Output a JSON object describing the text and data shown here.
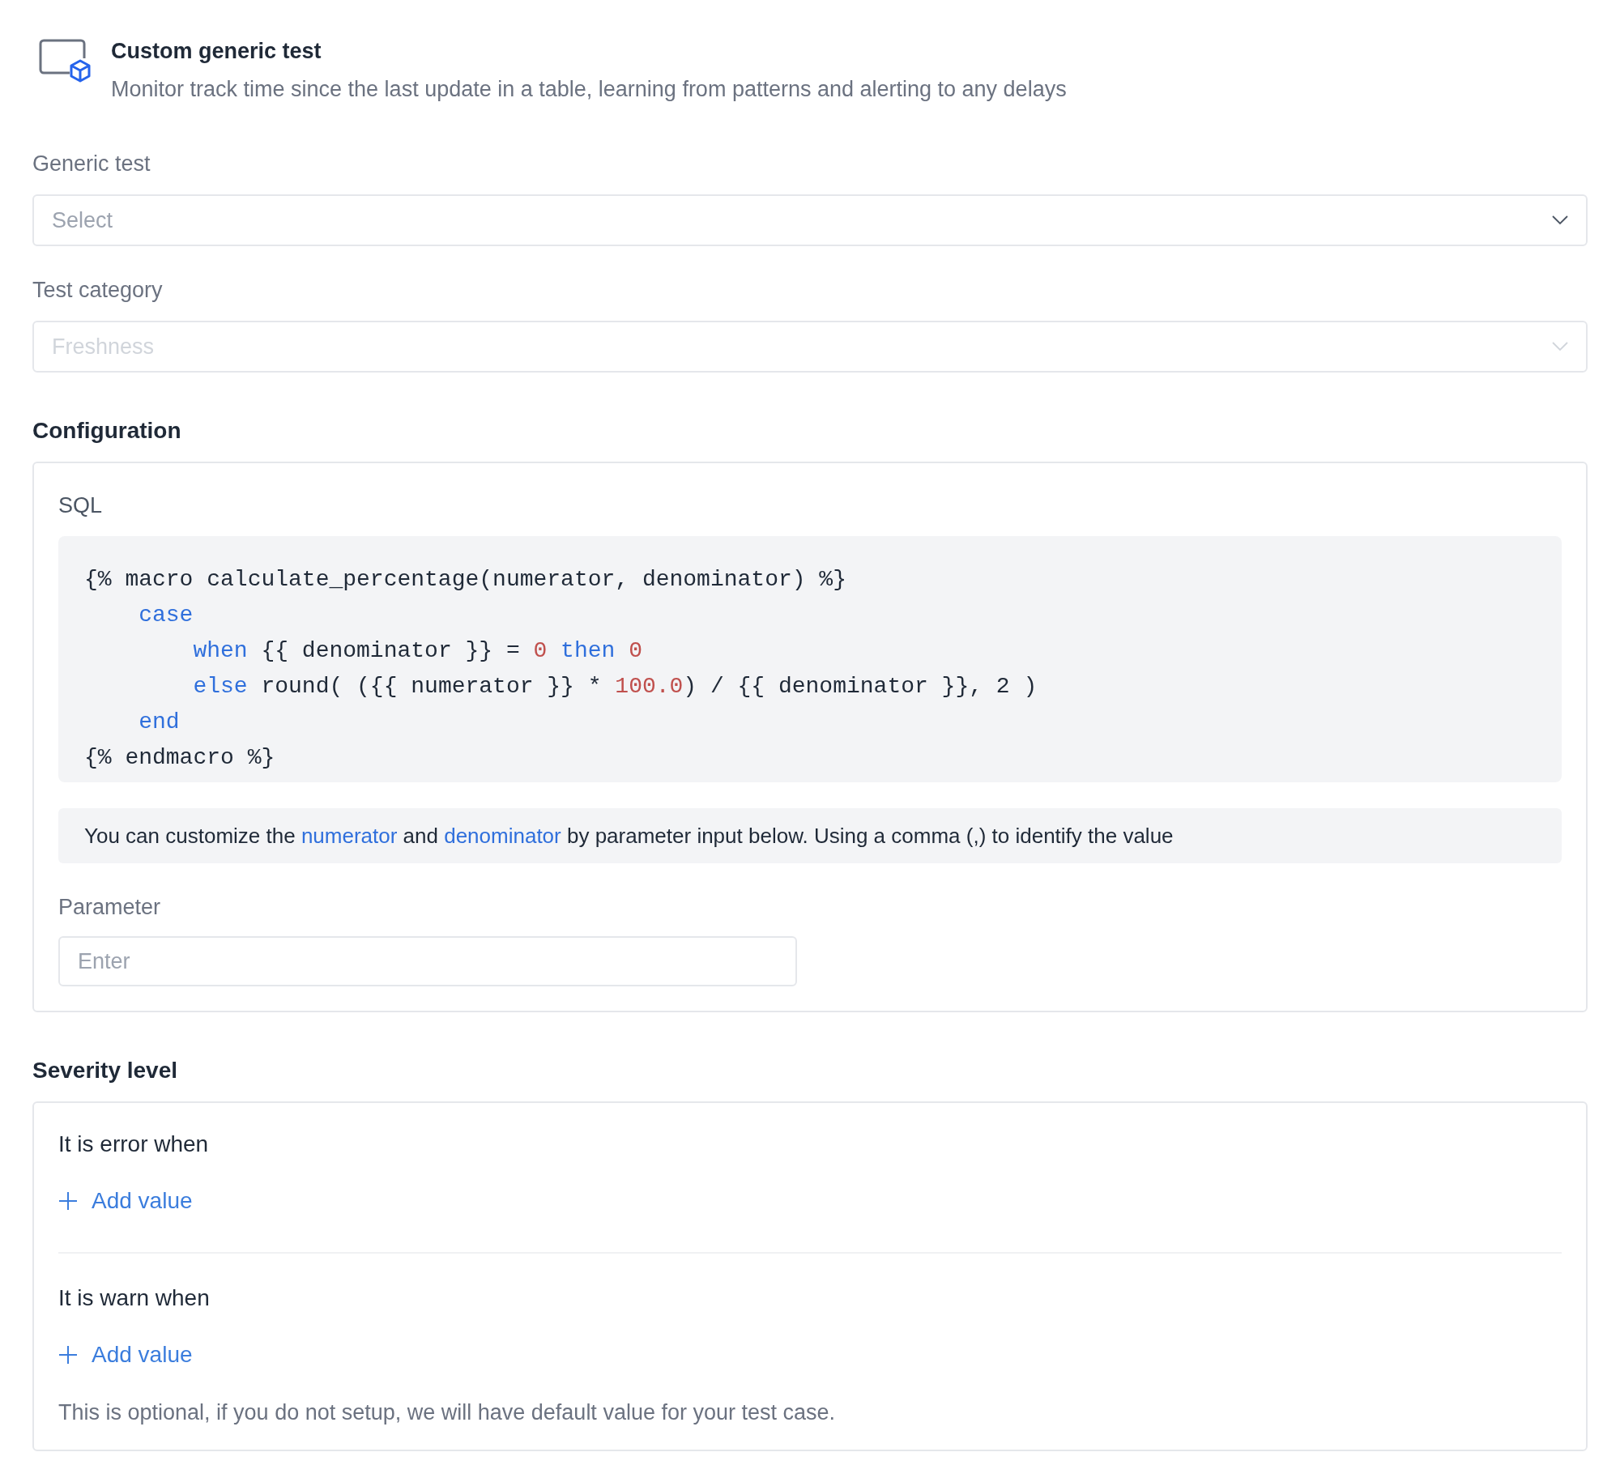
{
  "header": {
    "title": "Custom generic test",
    "description": "Monitor track time since the last update in a table, learning from patterns and alerting to any delays"
  },
  "fields": [
    {
      "label": "Generic test",
      "placeholder": "Select",
      "disabled": false
    },
    {
      "label": "Test category",
      "placeholder": "Freshness",
      "disabled": true
    }
  ],
  "configuration": {
    "heading": "Configuration",
    "sql_label": "SQL",
    "code_lines": [
      {
        "tokens": [
          {
            "kind": "plain",
            "text": "{% macro calculate_percentage(numerator, denominator) %}"
          }
        ],
        "children": [
          {
            "tokens": [
              {
                "kind": "keyword",
                "text": "case"
              }
            ],
            "children": [
              {
                "tokens": [
                  {
                    "kind": "keyword",
                    "text": "when"
                  },
                  {
                    "kind": "plain",
                    "text": " {{ denominator }} = "
                  },
                  {
                    "kind": "number",
                    "text": "0"
                  },
                  {
                    "kind": "keyword",
                    "text": " then"
                  },
                  {
                    "kind": "number",
                    "text": " 0"
                  }
                ]
              },
              {
                "tokens": [
                  {
                    "kind": "keyword",
                    "text": "else"
                  },
                  {
                    "kind": "plain",
                    "text": " round( ({{ numerator }} * "
                  },
                  {
                    "kind": "number",
                    "text": "100.0"
                  },
                  {
                    "kind": "plain",
                    "text": ") / {{ denominator }}, 2 )"
                  }
                ]
              }
            ]
          },
          {
            "tokens": [
              {
                "kind": "keyword",
                "text": "end"
              }
            ]
          }
        ]
      },
      {
        "tokens": [
          {
            "kind": "plain",
            "text": "{% endmacro %}"
          }
        ]
      }
    ],
    "note": [
      {
        "kind": "plain",
        "text": "You can customize the "
      },
      {
        "kind": "highlight",
        "text": "numerator"
      },
      {
        "kind": "plain",
        "text": " and "
      },
      {
        "kind": "highlight",
        "text": "denominator"
      },
      {
        "kind": "plain",
        "text": " by parameter input below. Using a comma (,) to identify the value"
      }
    ],
    "parameter": {
      "label": "Parameter",
      "placeholder": "Enter"
    }
  },
  "severity": {
    "heading": "Severity level",
    "conditions": [
      {
        "label": "It is error when",
        "button": "Add value"
      },
      {
        "label": "It is warn when",
        "button": "Add value"
      }
    ],
    "note": "This is optional, if you do not setup, we will have default value for your test case."
  }
}
